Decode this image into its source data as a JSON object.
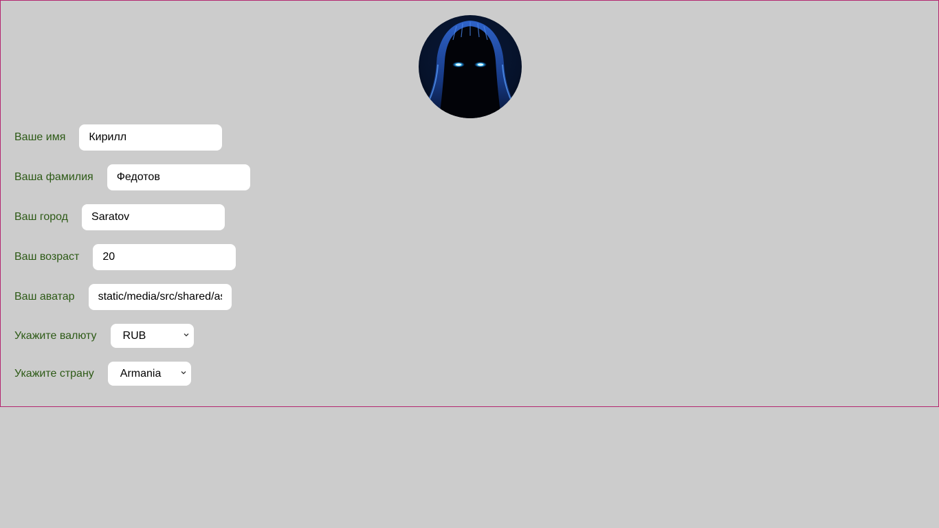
{
  "profile": {
    "avatar_alt": "hooded-figure-avatar",
    "first_name": {
      "label": "Ваше имя",
      "value": "Кирилл"
    },
    "last_name": {
      "label": "Ваша фамилия",
      "value": "Федотов"
    },
    "city": {
      "label": "Ваш город",
      "value": "Saratov"
    },
    "age": {
      "label": "Ваш возраст",
      "value": "20"
    },
    "avatar": {
      "label": "Ваш аватар",
      "value": "static/media/src/shared/assets/avatar.png"
    },
    "currency": {
      "label": "Укажите валюту",
      "value": "RUB"
    },
    "country": {
      "label": "Укажите страну",
      "value": "Armania"
    }
  },
  "colors": {
    "background": "#cccccc",
    "card_border": "#b3266f",
    "label": "#2d5a16"
  }
}
